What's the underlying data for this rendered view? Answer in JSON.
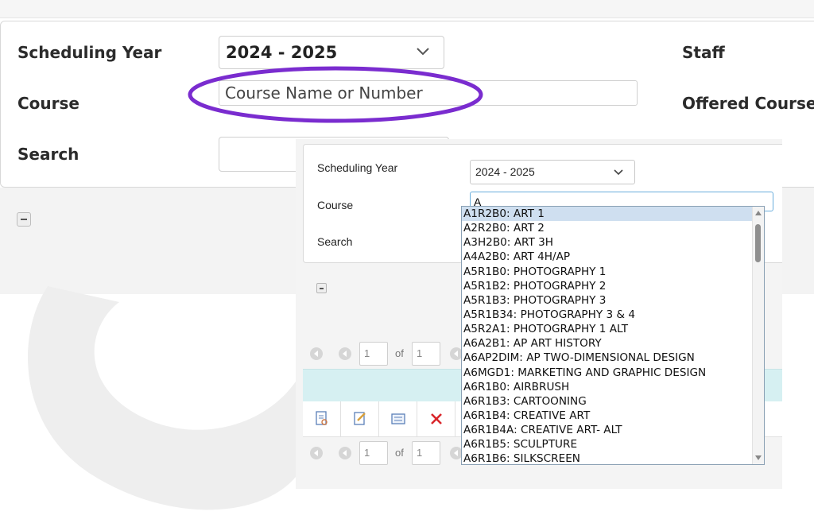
{
  "background_form": {
    "scheduling_year_label": "Scheduling Year",
    "scheduling_year_value": "2024 - 2025",
    "staff_label": "Staff",
    "course_label": "Course",
    "course_placeholder": "Course Name or Number",
    "offered_courses_label": "Offered Courses",
    "search_label": "Search",
    "highlight_color": "#7a2ccf"
  },
  "popup": {
    "scheduling_year_label": "Scheduling Year",
    "scheduling_year_value": "2024 - 2025",
    "course_label": "Course",
    "course_value": "A",
    "search_label": "Search",
    "pager_top": {
      "page": "1",
      "of_label": "of",
      "total": "1"
    },
    "pager_bottom": {
      "page": "1",
      "of_label": "of",
      "total": "1"
    },
    "toolbar_icons": [
      "view-document-icon",
      "edit-document-icon",
      "list-icon",
      "delete-icon"
    ],
    "course_options": [
      "A1R2B0: ART 1",
      "A2R2B0: ART 2",
      "A3H2B0: ART 3H",
      "A4A2B0: ART 4H/AP",
      "A5R1B0: PHOTOGRAPHY 1",
      "A5R1B2: PHOTOGRAPHY 2",
      "A5R1B3: PHOTOGRAPHY 3",
      "A5R1B34: PHOTOGRAPHY 3 & 4",
      "A5R2A1: PHOTOGRAPHY 1 ALT",
      "A6A2B1: AP ART HISTORY",
      "A6AP2DIM: AP TWO-DIMENSIONAL DESIGN",
      "A6MGD1: MARKETING AND GRAPHIC DESIGN",
      "A6R1B0: AIRBRUSH",
      "A6R1B3: CARTOONING",
      "A6R1B4: CREATIVE ART",
      "A6R1B4A: CREATIVE ART- ALT",
      "A6R1B5: SCULPTURE",
      "A6R1B6: SILKSCREEN"
    ],
    "selected_index": 0,
    "selection_color": "#cfdff0",
    "focus_border_color": "#6aaedc",
    "teal_row_color": "#d6f0f2",
    "delete_color": "#d9262b"
  }
}
